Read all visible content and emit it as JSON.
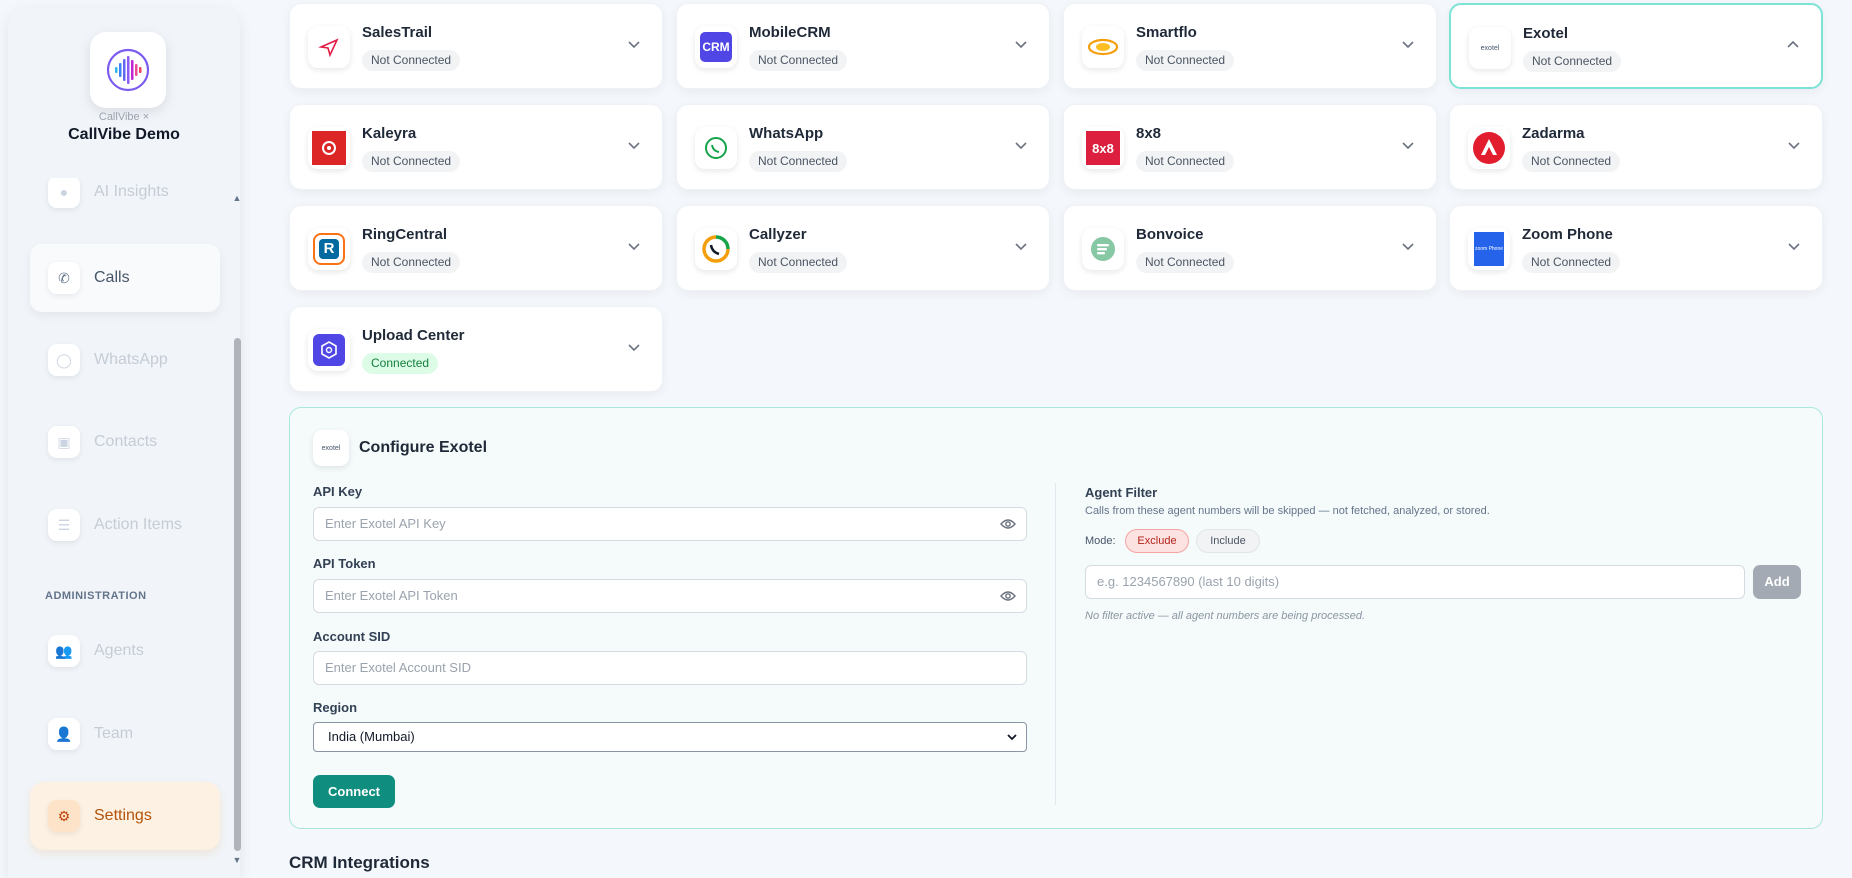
{
  "brand": {
    "sub": "CallVibe ×",
    "name": "CallVibe Demo"
  },
  "sidebar": {
    "items": [
      {
        "label": "AI Insights"
      },
      {
        "label": "Calls"
      },
      {
        "label": "WhatsApp"
      },
      {
        "label": "Contacts"
      },
      {
        "label": "Action Items"
      },
      {
        "label": "Agents"
      },
      {
        "label": "Team"
      },
      {
        "label": "Settings"
      }
    ],
    "section_admin": "ADMINISTRATION"
  },
  "integrations": [
    {
      "name": "SalesTrail",
      "status": "Not Connected"
    },
    {
      "name": "MobileCRM",
      "status": "Not Connected",
      "logo_text": "CRM"
    },
    {
      "name": "Smartflo",
      "status": "Not Connected"
    },
    {
      "name": "Exotel",
      "status": "Not Connected",
      "logo_text": "exotel"
    },
    {
      "name": "Kaleyra",
      "status": "Not Connected"
    },
    {
      "name": "WhatsApp",
      "status": "Not Connected"
    },
    {
      "name": "8x8",
      "status": "Not Connected",
      "logo_text": "8x8"
    },
    {
      "name": "Zadarma",
      "status": "Not Connected"
    },
    {
      "name": "RingCentral",
      "status": "Not Connected"
    },
    {
      "name": "Callyzer",
      "status": "Not Connected"
    },
    {
      "name": "Bonvoice",
      "status": "Not Connected"
    },
    {
      "name": "Zoom Phone",
      "status": "Not Connected",
      "logo_text": "zoom Phone"
    },
    {
      "name": "Upload Center",
      "status": "Connected"
    }
  ],
  "config": {
    "logo_text": "exotel",
    "title": "Configure Exotel",
    "api_key_label": "API Key",
    "api_key_placeholder": "Enter Exotel API Key",
    "api_token_label": "API Token",
    "api_token_placeholder": "Enter Exotel API Token",
    "account_sid_label": "Account SID",
    "account_sid_placeholder": "Enter Exotel Account SID",
    "region_label": "Region",
    "region_value": "India (Mumbai)",
    "connect_label": "Connect"
  },
  "agent_filter": {
    "title": "Agent Filter",
    "description": "Calls from these agent numbers will be skipped — not fetched, analyzed, or stored.",
    "mode_label": "Mode:",
    "exclude_label": "Exclude",
    "include_label": "Include",
    "placeholder": "e.g. 1234567890 (last 10 digits)",
    "add_label": "Add",
    "note": "No filter active — all agent numbers are being processed."
  },
  "crm_title": "CRM Integrations",
  "colors": {
    "accent": "#0f8e7f",
    "selected_border": "#7de3d6",
    "settings": "#b45309"
  }
}
